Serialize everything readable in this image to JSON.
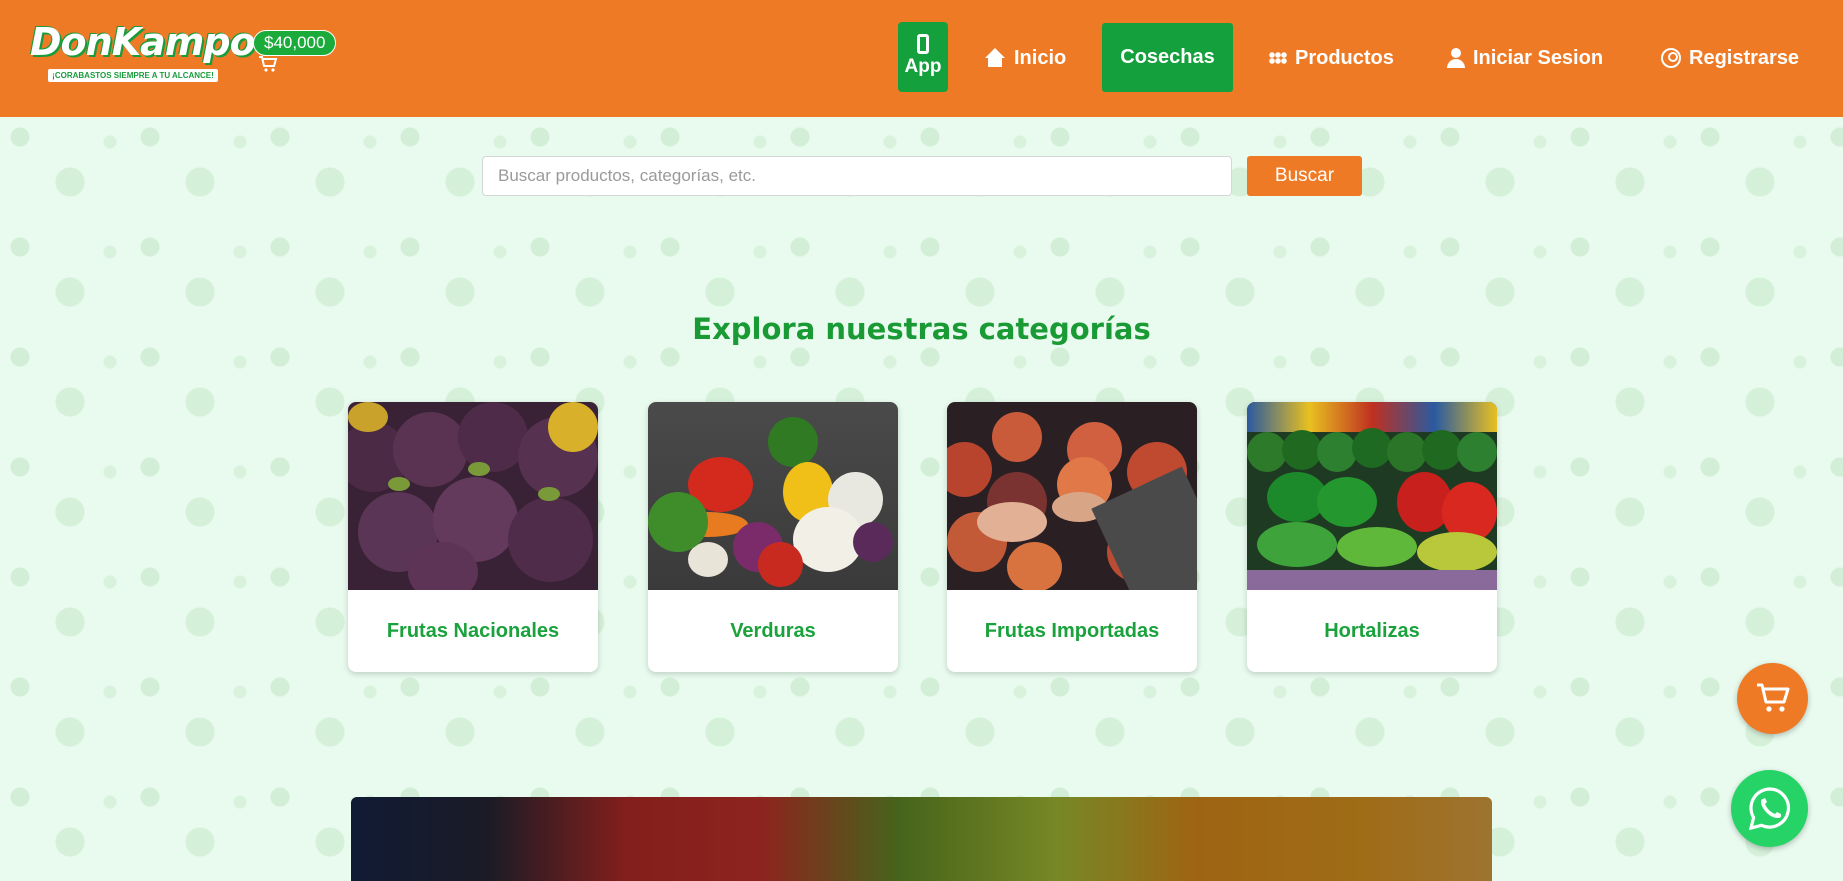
{
  "brand": {
    "logo_text": "DonKampo",
    "tagline": "¡CORABASTOS SIEMPRE A TU ALCANCE!",
    "balance": "$40,000"
  },
  "nav": {
    "app_label": "App",
    "inicio": "Inicio",
    "cosechas": "Cosechas",
    "productos": "Productos",
    "login": "Iniciar Sesion",
    "register": "Registrarse"
  },
  "search": {
    "placeholder": "Buscar productos, categorías, etc.",
    "button": "Buscar"
  },
  "categories": {
    "title": "Explora nuestras categorías",
    "items": [
      {
        "label": "Frutas Nacionales"
      },
      {
        "label": "Verduras"
      },
      {
        "label": "Frutas Importadas"
      },
      {
        "label": "Hortalizas"
      }
    ]
  },
  "colors": {
    "header": "#ef7a25",
    "accent_green": "#14a03c",
    "title_green": "#1a9a35",
    "background": "#e9fbef"
  },
  "icons": {
    "app": "phone-icon",
    "inicio": "home-icon",
    "productos": "grid-icon",
    "login": "user-icon",
    "register": "user-circle-icon",
    "floating_cart": "cart-icon",
    "whatsapp": "whatsapp-icon"
  }
}
